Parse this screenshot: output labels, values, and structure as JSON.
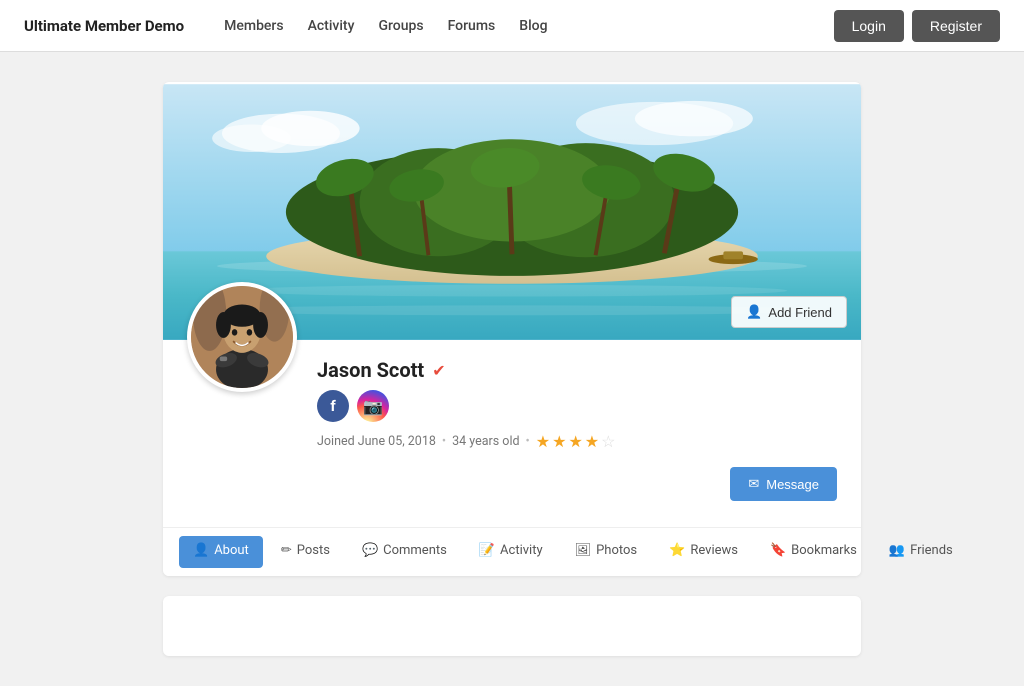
{
  "nav": {
    "brand": "Ultimate Member Demo",
    "links": [
      {
        "label": "Members",
        "href": "#"
      },
      {
        "label": "Activity",
        "href": "#"
      },
      {
        "label": "Groups",
        "href": "#"
      },
      {
        "label": "Forums",
        "href": "#"
      },
      {
        "label": "Blog",
        "href": "#"
      }
    ],
    "login_label": "Login",
    "register_label": "Register"
  },
  "profile": {
    "name": "Jason Scott",
    "verified": true,
    "joined": "Joined June 05, 2018",
    "age": "34 years old",
    "rating": 3.5,
    "add_friend_label": "Add Friend",
    "message_label": "Message",
    "social": [
      {
        "name": "facebook",
        "label": "f"
      },
      {
        "name": "instagram",
        "label": "📷"
      }
    ]
  },
  "tabs": [
    {
      "label": "About",
      "icon": "person",
      "active": true
    },
    {
      "label": "Posts",
      "icon": "pencil",
      "active": false
    },
    {
      "label": "Comments",
      "icon": "chat",
      "active": false
    },
    {
      "label": "Activity",
      "icon": "edit",
      "active": false
    },
    {
      "label": "Photos",
      "icon": "photo",
      "active": false
    },
    {
      "label": "Reviews",
      "icon": "star",
      "active": false
    },
    {
      "label": "Bookmarks",
      "icon": "bookmark",
      "active": false
    },
    {
      "label": "Friends",
      "icon": "group",
      "active": false
    }
  ],
  "colors": {
    "accent": "#4a90d9",
    "nav_bg": "#ffffff",
    "page_bg": "#f1f1f1"
  }
}
